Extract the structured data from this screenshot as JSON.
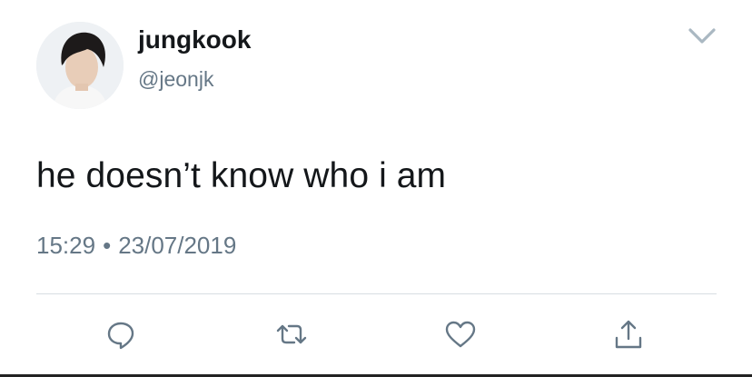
{
  "user": {
    "display_name": "jungkook",
    "handle": "@jeonjk"
  },
  "tweet": {
    "text": "he doesn’t know who i am",
    "time": "15:29",
    "separator": "•",
    "date": "23/07/2019"
  },
  "icons": {
    "menu": "chevron-down-icon",
    "reply": "reply-icon",
    "retweet": "retweet-icon",
    "like": "heart-icon",
    "share": "share-icon"
  },
  "colors": {
    "primary_text": "#14171a",
    "secondary_text": "#657786",
    "icon": "#657786",
    "divider": "#d8dde2"
  }
}
